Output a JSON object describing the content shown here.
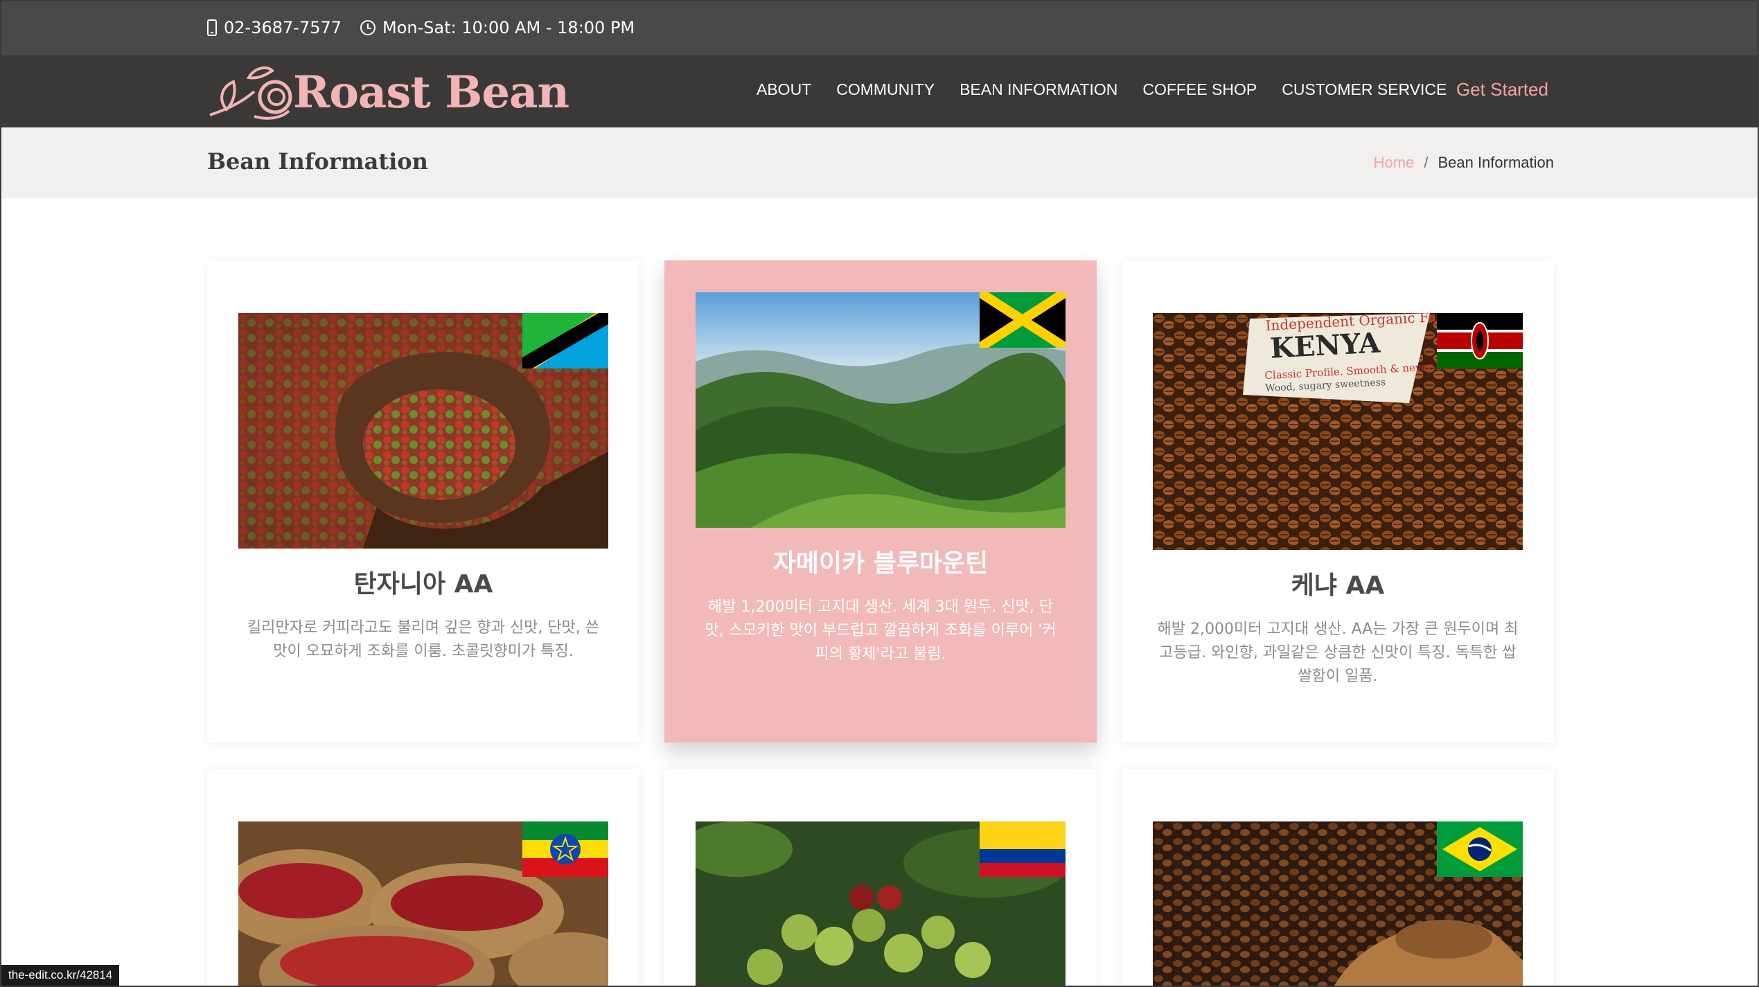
{
  "topbar": {
    "phone": "02-3687-7577",
    "hours": "Mon-Sat: 10:00 AM - 18:00 PM"
  },
  "header": {
    "logo_text": "Roast Bean",
    "nav": [
      "ABOUT",
      "COMMUNITY",
      "BEAN INFORMATION",
      "COFFEE SHOP",
      "CUSTOMER SERVICE"
    ],
    "cta": "Get Started"
  },
  "page": {
    "title": "Bean Information",
    "breadcrumb": {
      "home": "Home",
      "separator": "/",
      "current": "Bean Information"
    }
  },
  "cards": [
    {
      "name": "탄자니아 AA",
      "flag": "tanzania",
      "description": "킬리만자로 커피라고도 불리며 깊은 향과 신맛, 단맛, 쓴맛이 오묘하게 조화를 이룸. 초콜릿향미가 특징.",
      "featured": false
    },
    {
      "name": "자메이카 블루마운틴",
      "flag": "jamaica",
      "description": "해발 1,200미터 고지대 생산. 세계 3대 원두. 신맛, 단맛, 스모키한 맛이 부드럽고 깔끔하게 조화를 이루어 '커피의 황제'라고 불림.",
      "featured": true
    },
    {
      "name": "케냐 AA",
      "flag": "kenya",
      "description": "해발 2,000미터 고지대 생산. AA는 가장 큰 원두이며 최고등급. 와인향, 과일같은 상큼한 신맛이 특징. 독특한 쌉쌀함이 일품.",
      "featured": false
    },
    {
      "flag": "ethiopia",
      "featured": false
    },
    {
      "flag": "colombia",
      "featured": false
    },
    {
      "flag": "brazil",
      "featured": false
    }
  ],
  "watermark": "the-edit.co.kr/42814",
  "colors": {
    "topbar": "#4a4848",
    "header": "#3b3938",
    "accent": "#f2a5a5",
    "featured_card": "#f2b9b9",
    "crumb_band": "#f1f0ef"
  }
}
